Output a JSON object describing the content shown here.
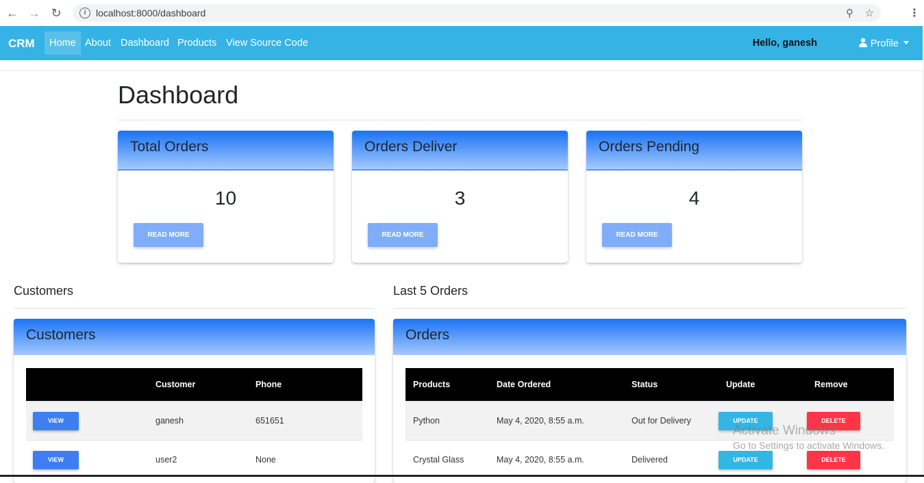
{
  "browser": {
    "url": "localhost:8000/dashboard",
    "back_icon": "arrow-left-icon",
    "forward_icon": "arrow-right-icon",
    "reload_icon": "reload-icon"
  },
  "navbar": {
    "brand": "CRM",
    "items": [
      {
        "label": "Home"
      },
      {
        "label": "About"
      },
      {
        "label": "Dashboard"
      },
      {
        "label": "Products"
      },
      {
        "label": "View Source Code"
      }
    ],
    "greeting": "Hello, ganesh",
    "profile_label": "Profile",
    "color": "#35b3e5"
  },
  "page": {
    "title": "Dashboard"
  },
  "stats": [
    {
      "title": "Total Orders",
      "value": "10",
      "button": "READ MORE"
    },
    {
      "title": "Orders Deliver",
      "value": "3",
      "button": "READ MORE"
    },
    {
      "title": "Orders Pending",
      "value": "4",
      "button": "READ MORE"
    }
  ],
  "customers_section": {
    "label": "Customers",
    "panel_title": "Customers",
    "columns": [
      "",
      "Customer",
      "Phone"
    ],
    "rows": [
      {
        "action": "VIEW",
        "customer": "ganesh",
        "phone": "651651"
      },
      {
        "action": "VIEW",
        "customer": "user2",
        "phone": "None"
      }
    ]
  },
  "orders_section": {
    "label": "Last 5 Orders",
    "panel_title": "Orders",
    "columns": [
      "Products",
      "Date Ordered",
      "Status",
      "Update",
      "Remove"
    ],
    "rows": [
      {
        "product": "Python",
        "date": "May 4, 2020, 8:55 a.m.",
        "status": "Out for Delivery",
        "update": "UPDATE",
        "remove": "DELETE"
      },
      {
        "product": "Crystal Glass",
        "date": "May 4, 2020, 8:55 a.m.",
        "status": "Delivered",
        "update": "UPDATE",
        "remove": "DELETE"
      }
    ]
  },
  "watermark": {
    "line1": "Activate Windows",
    "line2": "Go to Settings to activate Windows."
  }
}
